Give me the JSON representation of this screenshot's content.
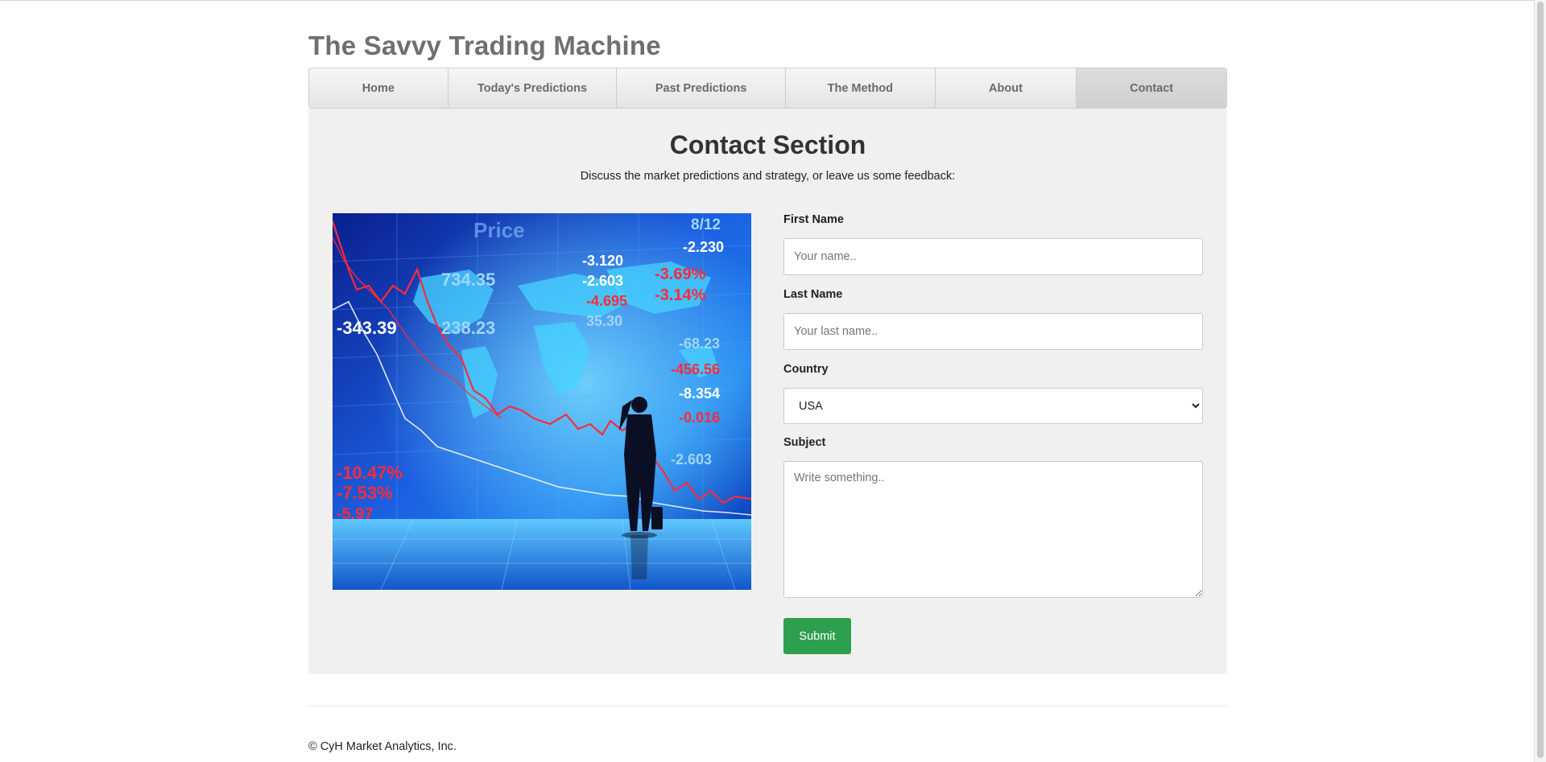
{
  "site": {
    "title": "The Savvy Trading Machine"
  },
  "nav": {
    "items": [
      {
        "label": "Home",
        "active": false
      },
      {
        "label": "Today's Predictions",
        "active": false
      },
      {
        "label": "Past Predictions",
        "active": false
      },
      {
        "label": "The Method",
        "active": false
      },
      {
        "label": "About",
        "active": false
      },
      {
        "label": "Contact",
        "active": true
      }
    ]
  },
  "contact": {
    "title": "Contact Section",
    "subtitle": "Discuss the market predictions and strategy, or leave us some feedback:",
    "image": {
      "ticker_values": [
        "-2.230",
        "-3.120",
        "-2.603",
        "-3.69%",
        "-3.14%",
        "-4.695",
        "35.30",
        "-68.23",
        "-456.56",
        "-8.354",
        "-0.016",
        "-2.603",
        "734.35",
        "238.23",
        "-343.39",
        "-10.47%",
        "-7.53%",
        "-5.97",
        "8/12",
        "Price"
      ]
    },
    "form": {
      "first_name": {
        "label": "First Name",
        "placeholder": "Your name..",
        "value": ""
      },
      "last_name": {
        "label": "Last Name",
        "placeholder": "Your last name..",
        "value": ""
      },
      "country": {
        "label": "Country",
        "selected": "USA"
      },
      "subject": {
        "label": "Subject",
        "placeholder": "Write something..",
        "value": ""
      },
      "submit_label": "Submit"
    }
  },
  "footer": {
    "copyright": "© CyH Market Analytics, Inc."
  },
  "colors": {
    "submit": "#2e9f4e",
    "content_bg": "#f0f0f0",
    "title_gray": "#6f6f6f"
  }
}
